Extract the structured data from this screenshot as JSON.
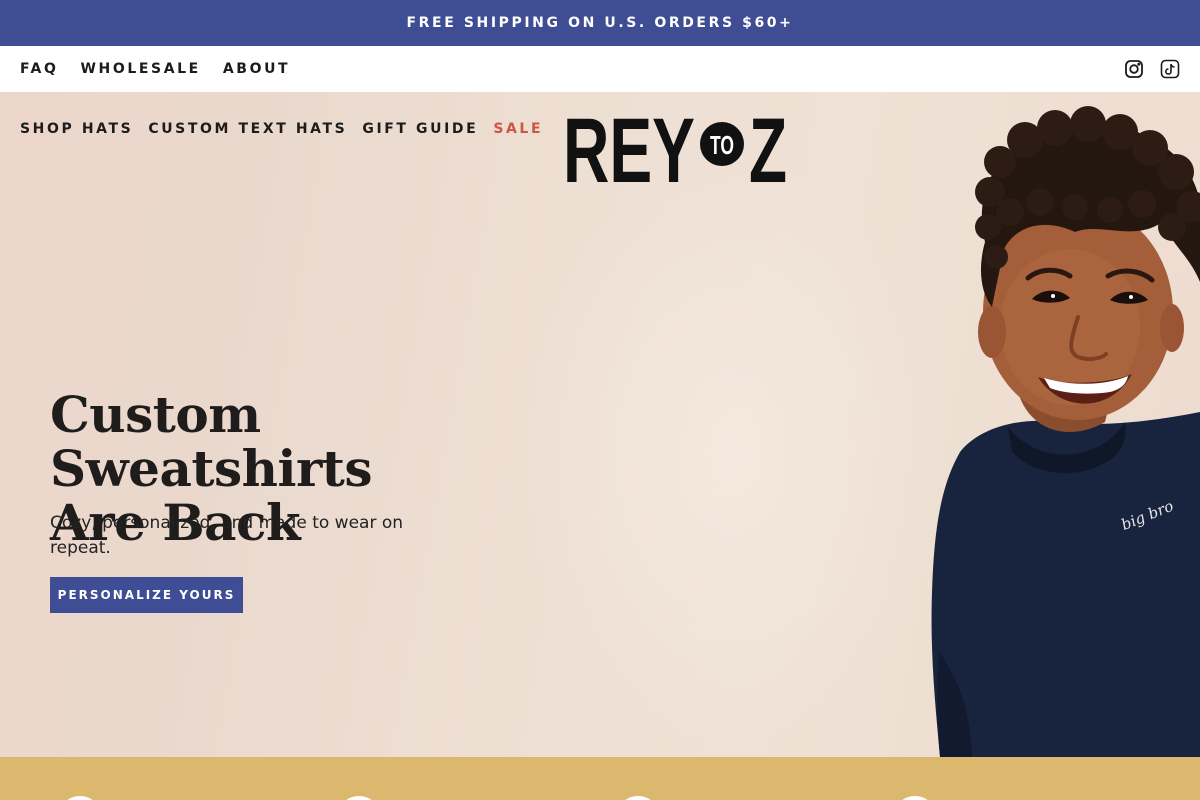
{
  "announcement": {
    "text": "FREE SHIPPING ON U.S. ORDERS $60+"
  },
  "utility_nav": {
    "links": [
      {
        "label": "FAQ"
      },
      {
        "label": "WHOLESALE"
      },
      {
        "label": "ABOUT"
      }
    ],
    "social_icons": [
      "instagram-icon",
      "tiktok-icon"
    ]
  },
  "main_nav": {
    "items": [
      {
        "label": "SHOP HATS"
      },
      {
        "label": "CUSTOM TEXT HATS"
      },
      {
        "label": "GIFT GUIDE"
      },
      {
        "label": "SALE"
      }
    ]
  },
  "logo": {
    "left": "REY",
    "middle": "TO",
    "right": "Z"
  },
  "hero": {
    "title_line1": "Custom Sweatshirts",
    "title_line2": "Are Back",
    "subtitle": "Cozy, personalized, and made to wear on repeat.",
    "cta_label": "PERSONALIZE YOURS",
    "sweatshirt_embroidery": "big bro"
  },
  "colors": {
    "brand_blue": "#3e4d94",
    "sale_red": "#cc5641",
    "strip_gold": "#dcb86f",
    "hero_bg": "#ecdbcf",
    "text_dark": "#1c1c1c"
  }
}
